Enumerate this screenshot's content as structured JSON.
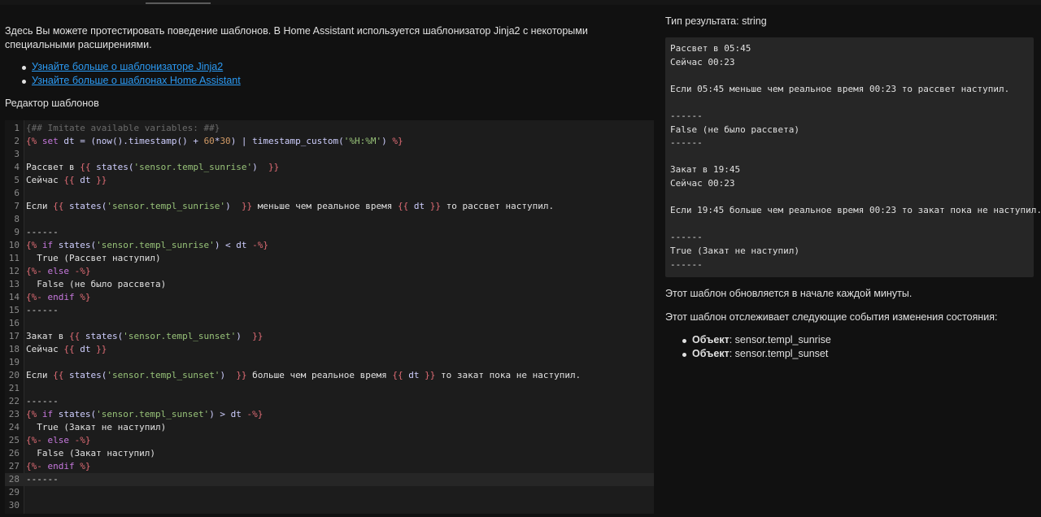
{
  "intro": {
    "text": "Здесь Вы можете протестировать поведение шаблонов. В Home Assistant используется шаблонизатор Jinja2 с некоторыми специальными расширениями."
  },
  "links": [
    {
      "label": "Узнайте больше о шаблонизаторе Jinja2"
    },
    {
      "label": "Узнайте больше о шаблонах Home Assistant"
    }
  ],
  "editor": {
    "title": "Редактор шаблонов",
    "lines": [
      "{## Imitate available variables: ##}",
      "{% set dt = (now().timestamp() + 60*30) | timestamp_custom('%H:%M') %}",
      "",
      "Рассвет в {{ states('sensor.templ_sunrise')  }}",
      "Сейчас {{ dt }}",
      "",
      "Если {{ states('sensor.templ_sunrise')  }} меньше чем реальное время {{ dt }} то рассвет наступил.",
      "",
      "------",
      "{% if states('sensor.templ_sunrise') < dt -%}",
      "  True (Рассвет наступил)",
      "{%- else -%}",
      "  False (не было рассвета)",
      "{%- endif %}",
      "------",
      "",
      "Закат в {{ states('sensor.templ_sunset')  }}",
      "Сейчас {{ dt }}",
      "",
      "Если {{ states('sensor.templ_sunset')  }} больше чем реальное время {{ dt }} то закат пока не наступил.",
      "",
      "------",
      "{% if states('sensor.templ_sunset') > dt -%}",
      "  True (Закат не наступил)",
      "{%- else -%}",
      "  False (Закат наступил)",
      "{%- endif %}",
      "------",
      "",
      ""
    ],
    "active_line": 28
  },
  "result": {
    "type_label": "Тип результата: string",
    "lines": [
      "Рассвет в 05:45",
      "Сейчас 00:23",
      "",
      "Если 05:45 меньше чем реальное время 00:23 то рассвет наступил.",
      "",
      "------",
      "False (не было рассвета)",
      "------",
      "",
      "Закат в 19:45",
      "Сейчас 00:23",
      "",
      "Если 19:45 больше чем реальное время 00:23 то закат пока не наступил.",
      "",
      "------",
      "True (Закат не наступил)",
      "------"
    ]
  },
  "notes": {
    "update": "Этот шаблон обновляется в начале каждой минуты.",
    "tracking": "Этот шаблон отслеживает следующие события изменения состояния:"
  },
  "entities": [
    {
      "label": "Объект",
      "value": ": sensor.templ_sunrise"
    },
    {
      "label": "Объект",
      "value": ": sensor.templ_sunset"
    }
  ],
  "colors": {
    "background": "#111111",
    "editor_bg": "#1c1c1c",
    "result_bg": "#262626",
    "link": "#2b9af3",
    "template_delimiter": "#e06c75",
    "keyword": "#c678dd",
    "string": "#98c379",
    "number": "#d19a66"
  }
}
